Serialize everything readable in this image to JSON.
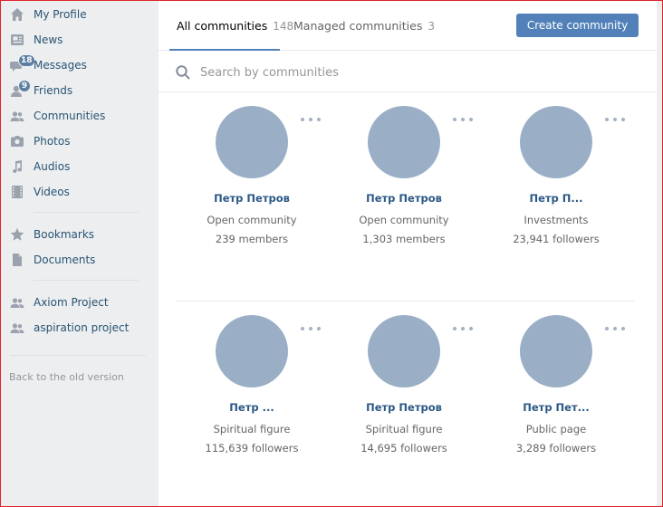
{
  "sidebar": {
    "items": [
      {
        "label": "My Profile",
        "icon": "home-icon"
      },
      {
        "label": "News",
        "icon": "news-icon"
      },
      {
        "label": "Messages",
        "icon": "messages-icon",
        "badge": "18"
      },
      {
        "label": "Friends",
        "icon": "friends-icon",
        "badge": "9"
      },
      {
        "label": "Communities",
        "icon": "communities-icon"
      },
      {
        "label": "Photos",
        "icon": "camera-icon"
      },
      {
        "label": "Audios",
        "icon": "music-icon"
      },
      {
        "label": "Videos",
        "icon": "film-icon"
      },
      {
        "label": "Bookmarks",
        "icon": "star-icon"
      },
      {
        "label": "Documents",
        "icon": "document-icon"
      },
      {
        "label": "Axiom Project",
        "icon": "group-icon"
      },
      {
        "label": "aspiration project",
        "icon": "group-icon"
      }
    ],
    "old_version": "Back to the old version"
  },
  "tabs": {
    "all_label": "All communities",
    "all_count": "148",
    "managed_label": "Managed communities",
    "managed_count": "3"
  },
  "create_button": "Create community",
  "search": {
    "placeholder": "Search by communities"
  },
  "communities": [
    {
      "name": "Петр Петров",
      "type": "Open community",
      "members": "239 members"
    },
    {
      "name": "Петр Петров",
      "type": "Open community",
      "members": "1,303 members"
    },
    {
      "name": "Петр П...",
      "type": "Investments",
      "members": "23,941 followers"
    },
    {
      "name": "Петр ...",
      "type": "Spiritual figure",
      "members": "115,639 followers"
    },
    {
      "name": "Петр Петров",
      "type": "Spiritual figure",
      "members": "14,695 followers"
    },
    {
      "name": "Петр Пет...",
      "type": "Public page",
      "members": "3,289 followers"
    }
  ],
  "colors": {
    "accent": "#5181b8",
    "avatar": "#9aafc6",
    "link": "#2a5885"
  }
}
